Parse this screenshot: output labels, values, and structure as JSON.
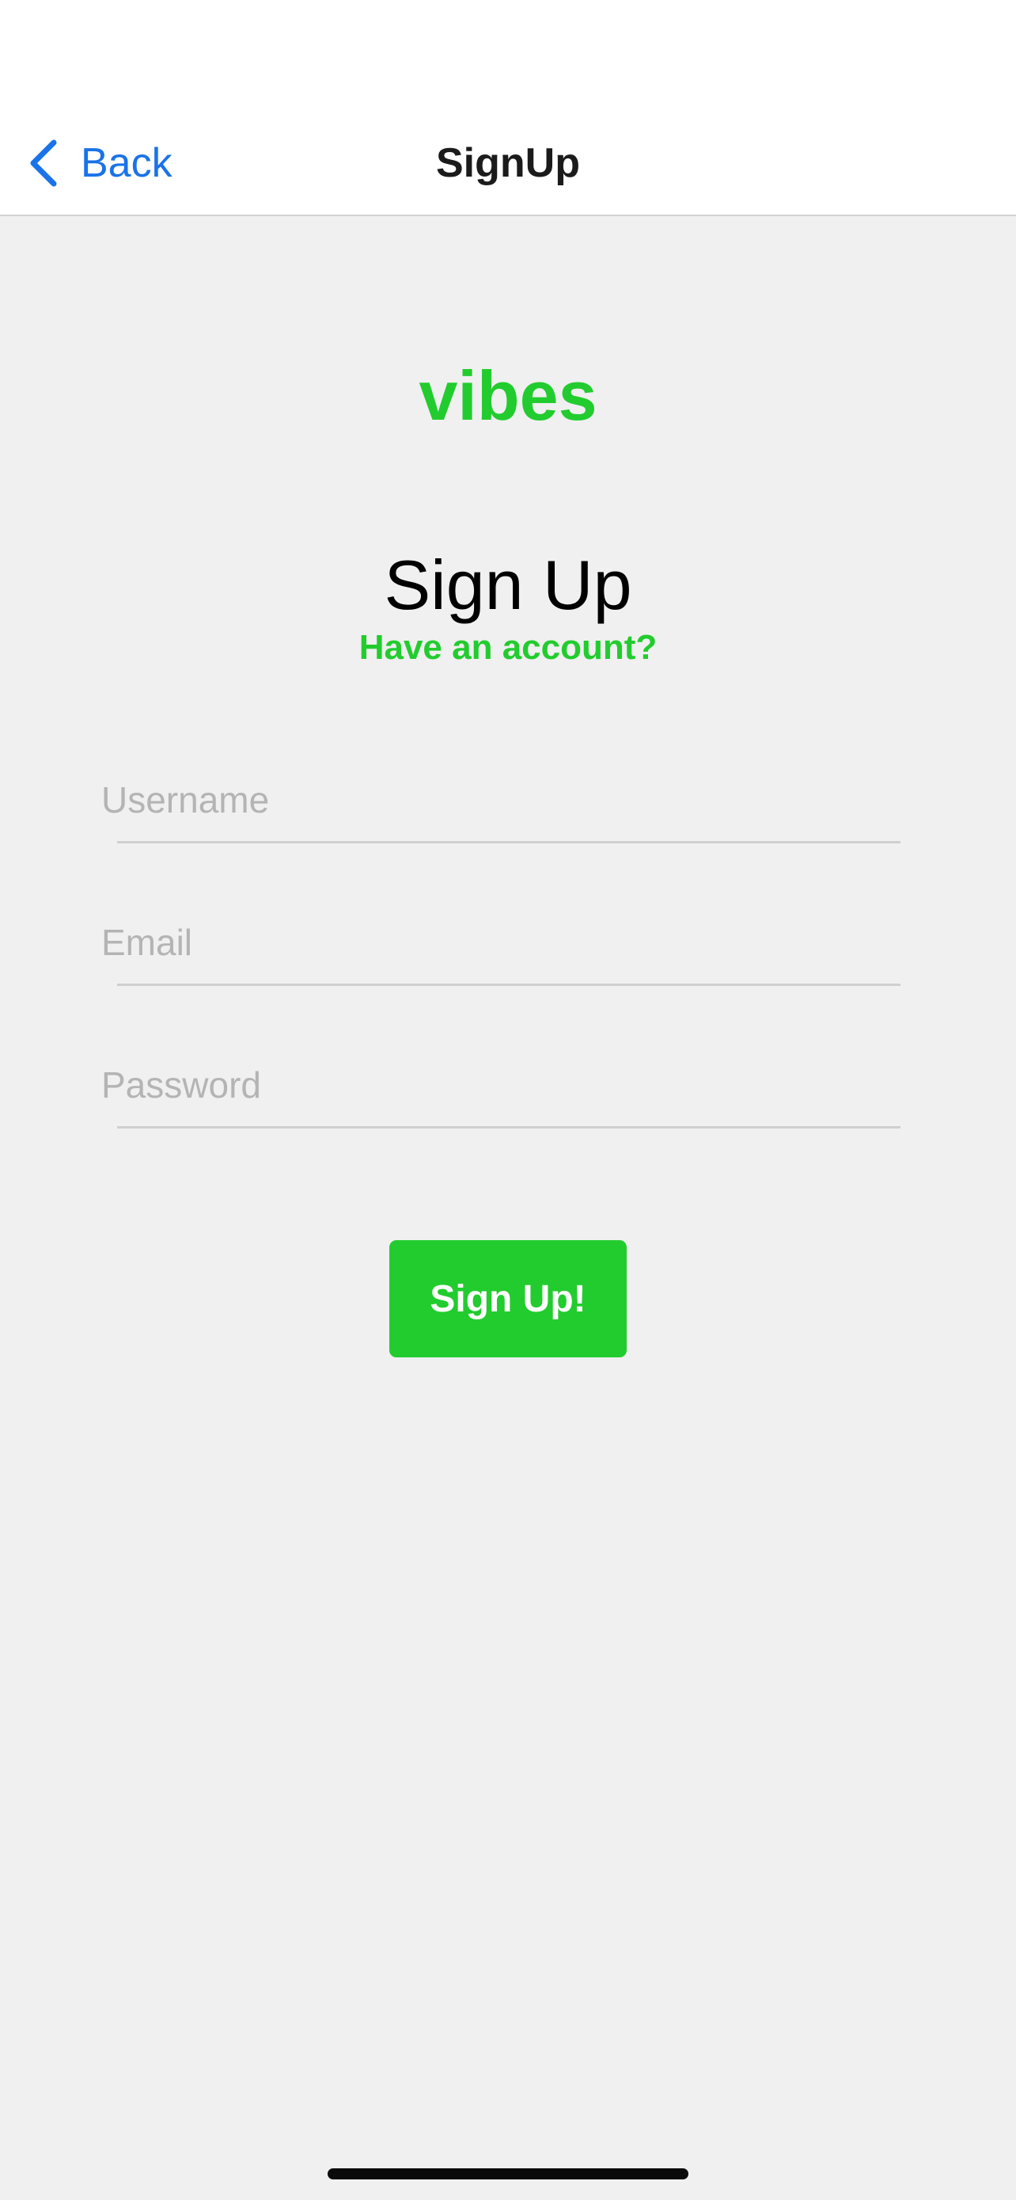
{
  "nav": {
    "back_label": "Back",
    "title": "SignUp"
  },
  "logo": {
    "text": "vibes"
  },
  "form": {
    "heading": "Sign Up",
    "have_account_link": "Have an account?",
    "username_placeholder": "Username",
    "username_value": "",
    "email_placeholder": "Email",
    "email_value": "",
    "password_placeholder": "Password",
    "password_value": "",
    "submit_label": "Sign Up!"
  },
  "icons": {
    "back": "chevron-left-icon"
  },
  "colors": {
    "accent": "#22cc2e",
    "link_blue": "#1a73e8",
    "background": "#f0f0f0",
    "bar_background": "#ffffff",
    "placeholder": "#b4b4b4",
    "divider": "#cfcfcf"
  }
}
